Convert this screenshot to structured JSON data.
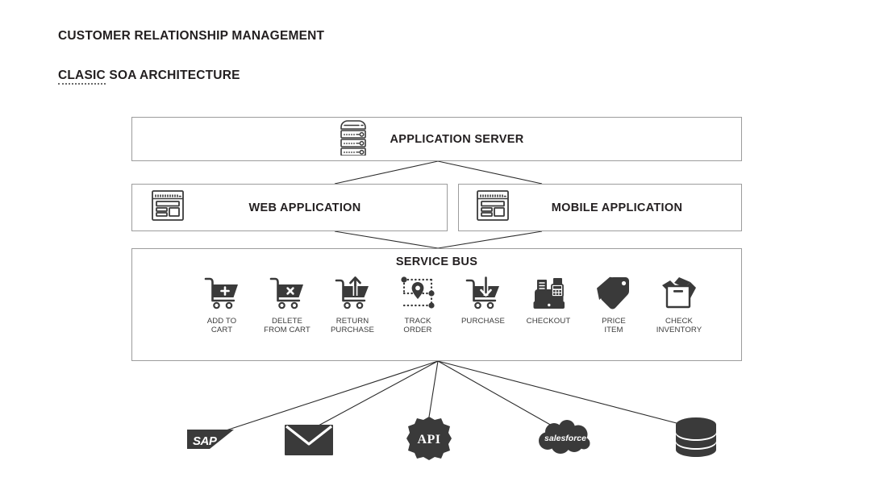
{
  "titles": {
    "main": "CUSTOMER RELATIONSHIP MANAGEMENT",
    "sub_misspelled": "CLASIC",
    "sub_rest": " SOA ARCHITECTURE"
  },
  "colors": {
    "ink": "#3a3a3a",
    "text": "#231f20",
    "border": "#9c9c9c",
    "background": "#ffffff",
    "connector": "#2b2b2b"
  },
  "tiers": {
    "application_server": {
      "label": "APPLICATION SERVER",
      "icon": "server-rack-icon"
    },
    "web_application": {
      "label": "WEB APPLICATION",
      "icon": "browser-window-icon"
    },
    "mobile_application": {
      "label": "MOBILE APPLICATION",
      "icon": "browser-window-icon"
    },
    "service_bus": {
      "label": "SERVICE BUS"
    }
  },
  "services": [
    {
      "label": "ADD TO\nCART",
      "icon": "cart-plus-icon"
    },
    {
      "label": "DELETE\nFROM CART",
      "icon": "cart-remove-icon"
    },
    {
      "label": "RETURN\nPURCHASE",
      "icon": "cart-arrow-up-icon"
    },
    {
      "label": "TRACK\nORDER",
      "icon": "route-pin-icon"
    },
    {
      "label": "PURCHASE",
      "icon": "cart-arrow-down-icon"
    },
    {
      "label": "CHECKOUT",
      "icon": "cash-register-icon"
    },
    {
      "label": "PRICE\nITEM",
      "icon": "price-tags-icon"
    },
    {
      "label": "CHECK\nINVENTORY",
      "icon": "open-box-icon"
    }
  ],
  "backends": [
    {
      "name": "sap-logo-icon",
      "label": "SAP"
    },
    {
      "name": "email-envelope-icon",
      "label": ""
    },
    {
      "name": "api-gear-icon",
      "label": "API"
    },
    {
      "name": "salesforce-cloud-icon",
      "label": "salesforce"
    },
    {
      "name": "database-cylinder-icon",
      "label": ""
    }
  ]
}
